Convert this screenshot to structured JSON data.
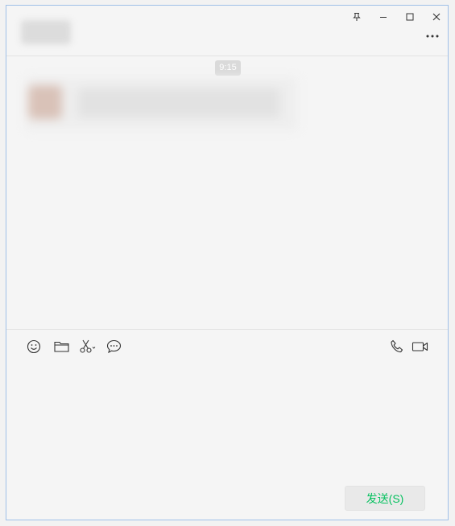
{
  "header": {
    "contact_name": "",
    "controls": [
      "pin-icon",
      "minimize-icon",
      "maximize-icon",
      "close-icon"
    ],
    "more_icon": "more-icon"
  },
  "chat": {
    "timestamp": "9:15",
    "message": {
      "text": ""
    }
  },
  "toolbar": {
    "left_tools": [
      "emoji-icon",
      "folder-icon",
      "scissors-icon",
      "chat-bubble-icon"
    ],
    "right_tools": [
      "phone-icon",
      "video-icon"
    ]
  },
  "composer": {
    "send_label": "发送(S)"
  },
  "colors": {
    "accent": "#07c160",
    "window_border": "#9fc0e8",
    "background": "#f5f5f5",
    "timestamp_bg": "#dadada"
  }
}
